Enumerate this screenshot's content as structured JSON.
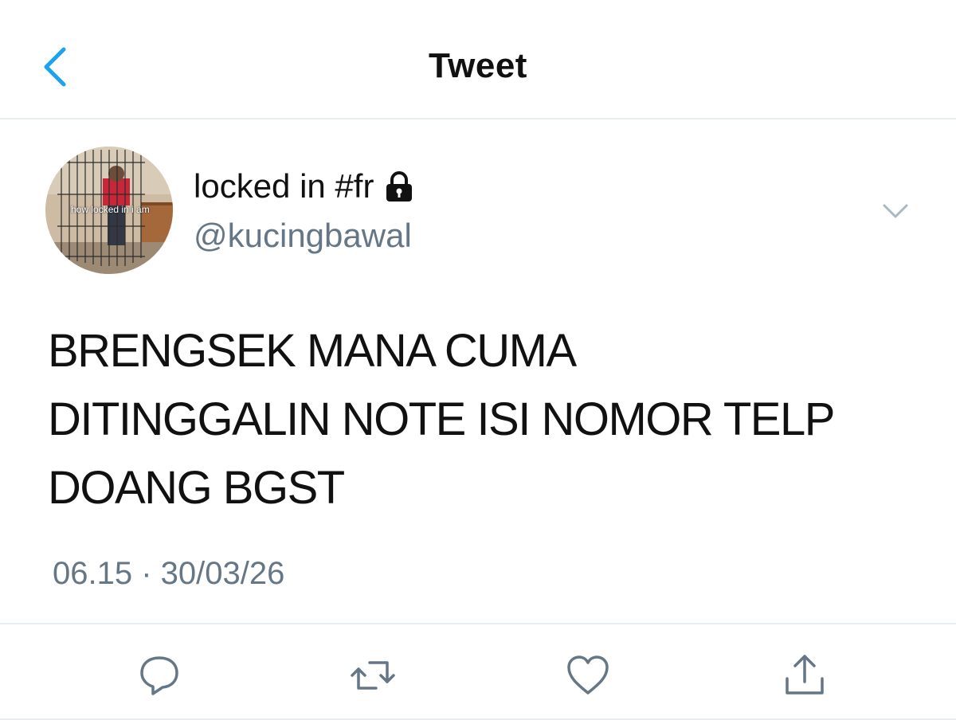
{
  "header": {
    "title": "Tweet",
    "back_icon": "chevron-left-icon",
    "accent_color": "#1da1f2"
  },
  "tweet": {
    "avatar_caption": "how locked in i am",
    "display_name": "locked in #fr",
    "lock_icon": "lock-icon",
    "handle": "@kucingbawal",
    "more_icon": "chevron-down-icon",
    "text_lines": [
      "BRENGSEK MANA CUMA",
      "DITINGGALIN NOTE ISI NOMOR TELP",
      "DOANG BGST"
    ],
    "timestamp": "06.15 · 30/03/26"
  },
  "actions": {
    "reply_icon": "reply-icon",
    "retweet_icon": "retweet-icon",
    "like_icon": "heart-icon",
    "share_icon": "share-icon",
    "icon_color": "#657786"
  }
}
